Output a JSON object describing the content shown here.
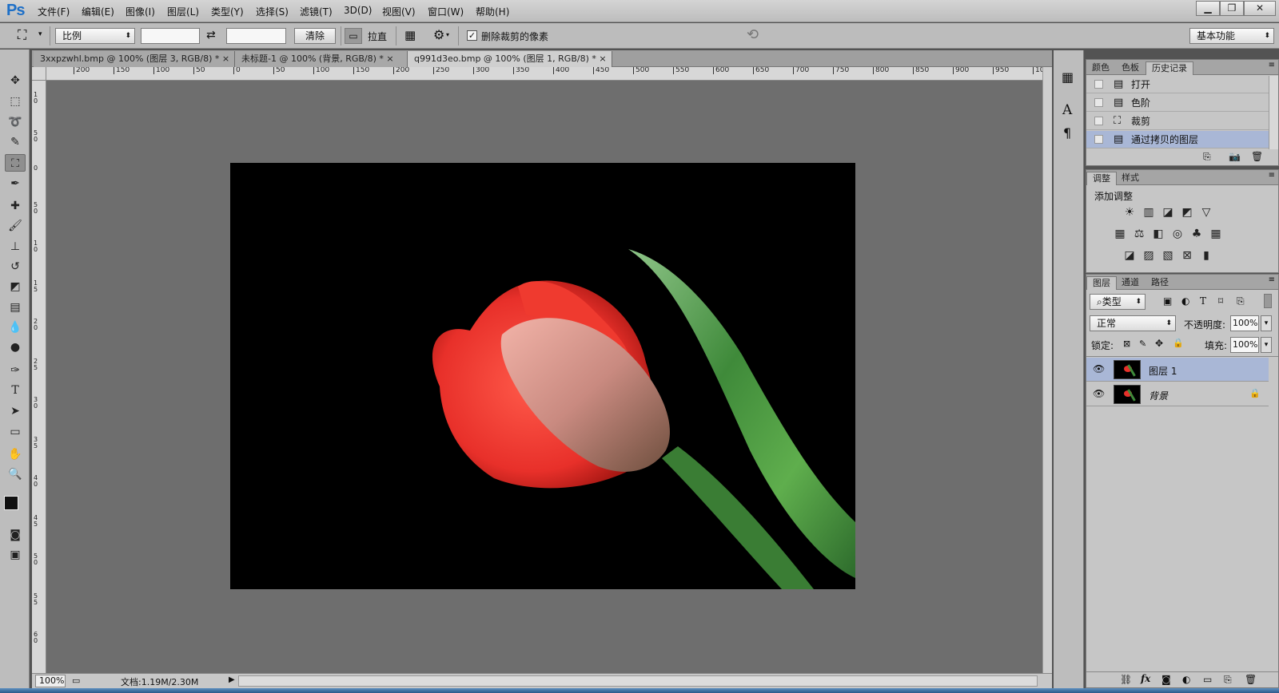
{
  "app": {
    "logo": "Ps"
  },
  "menu": [
    "文件(F)",
    "编辑(E)",
    "图像(I)",
    "图层(L)",
    "类型(Y)",
    "选择(S)",
    "滤镜(T)",
    "3D(D)",
    "视图(V)",
    "窗口(W)",
    "帮助(H)"
  ],
  "window_buttons": {
    "minimize": "▁",
    "restore": "❐",
    "close": "✕"
  },
  "options": {
    "ratio_select": "比例",
    "width_value": "",
    "height_value": "",
    "clear_label": "清除",
    "straighten_label": "拉直",
    "delete_cropped_label": "删除裁剪的像素",
    "delete_cropped_checked": true,
    "workspace": "基本功能"
  },
  "tabs": [
    {
      "label": "3xxpzwhl.bmp @ 100% (图层 3, RGB/8) *",
      "close": "×",
      "active": false
    },
    {
      "label": "未标题-1 @ 100% (背景, RGB/8) *",
      "close": "×",
      "active": false
    },
    {
      "label": "q991d3eo.bmp @ 100% (图层 1, RGB/8) *",
      "close": "×",
      "active": true
    }
  ],
  "ruler_h": [
    "200",
    "150",
    "100",
    "50",
    "0",
    "50",
    "100",
    "150",
    "200",
    "250",
    "300",
    "350",
    "400",
    "450",
    "500",
    "550",
    "600",
    "650",
    "700",
    "750",
    "800",
    "850",
    "900",
    "950",
    "10"
  ],
  "ruler_v": [
    "1 0",
    "5 0",
    "0",
    "5 0",
    "1 0",
    "1 5",
    "2 0",
    "2 5",
    "3 0",
    "3 5",
    "4 0",
    "4 5",
    "5 0",
    "5 5",
    "6 0"
  ],
  "status": {
    "zoom": "100%",
    "doc_info": "文档:1.19M/2.30M"
  },
  "history_panel": {
    "tabs": [
      "颜色",
      "色板",
      "历史记录"
    ],
    "items": [
      {
        "label": "打开",
        "icon": "document-icon",
        "selected": false
      },
      {
        "label": "色阶",
        "icon": "document-icon",
        "selected": false
      },
      {
        "label": "裁剪",
        "icon": "crop-icon",
        "selected": false
      },
      {
        "label": "通过拷贝的图层",
        "icon": "document-icon",
        "selected": true
      }
    ]
  },
  "adjust_panel": {
    "tabs": [
      "调整",
      "样式"
    ],
    "title": "添加调整"
  },
  "layers_panel": {
    "tabs": [
      "图层",
      "通道",
      "路径"
    ],
    "filter": "类型",
    "blend_mode": "正常",
    "opacity_label": "不透明度:",
    "opacity_value": "100%",
    "lock_label": "锁定:",
    "fill_label": "填充:",
    "fill_value": "100%",
    "layers": [
      {
        "name": "图层 1",
        "selected": true,
        "visible": true,
        "locked": false
      },
      {
        "name": "背景",
        "selected": false,
        "visible": true,
        "locked": true
      }
    ]
  },
  "colors": {
    "chrome": "#bdbdbd",
    "workspace": "#6e6e6e",
    "selection": "#a9b7d6",
    "tulip_red": "#e8302a",
    "leaf_green": "#3f8a3a"
  }
}
